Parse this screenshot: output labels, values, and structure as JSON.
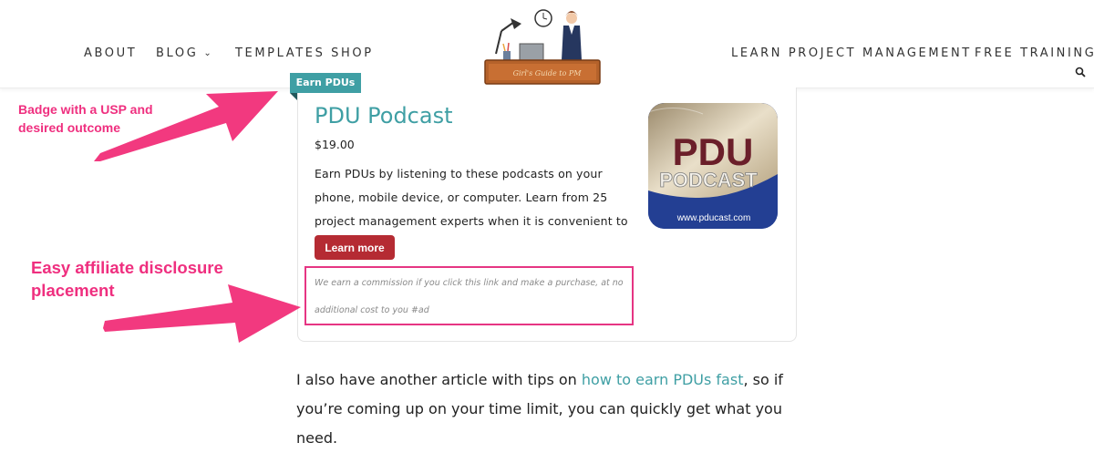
{
  "nav": {
    "left": [
      {
        "label": "ABOUT"
      },
      {
        "label": "BLOG"
      },
      {
        "label": "TEMPLATES SHOP"
      }
    ],
    "right": [
      {
        "label": "LEARN PROJECT MANAGEMENT"
      },
      {
        "label": "FREE TRAINING"
      }
    ]
  },
  "logo": {
    "caption": "Girl's Guide to PM"
  },
  "product": {
    "badge": "Earn PDUs",
    "title": "PDU Podcast",
    "price": "$19.00",
    "description": "Earn PDUs by listening to these podcasts on your phone, mobile device, or computer. Learn from 25 project management experts when it is convenient to you.",
    "button_label": "Learn more",
    "disclosure": "We earn a commission if you click this link and make a purchase, at no additional cost to you #ad",
    "image": {
      "line1": "PDU",
      "line2": "PODCAST",
      "url_text": "www.pducast.com"
    }
  },
  "annotations": {
    "badge_note_line1": "Badge with a USP and",
    "badge_note_line2": "desired outcome",
    "disclosure_note_line1": "Easy affiliate disclosure",
    "disclosure_note_line2": "placement"
  },
  "article": {
    "text_before": "I also have another article with tips on ",
    "link_text": "how to earn PDUs fast",
    "text_after": ", so if you’re coming up on your time limit, you can quickly get what you need."
  },
  "colors": {
    "accent_teal": "#3f9fa4",
    "button_red": "#b52b33",
    "annotation_pink": "#ef2f7f",
    "image_blue": "#233f93"
  }
}
